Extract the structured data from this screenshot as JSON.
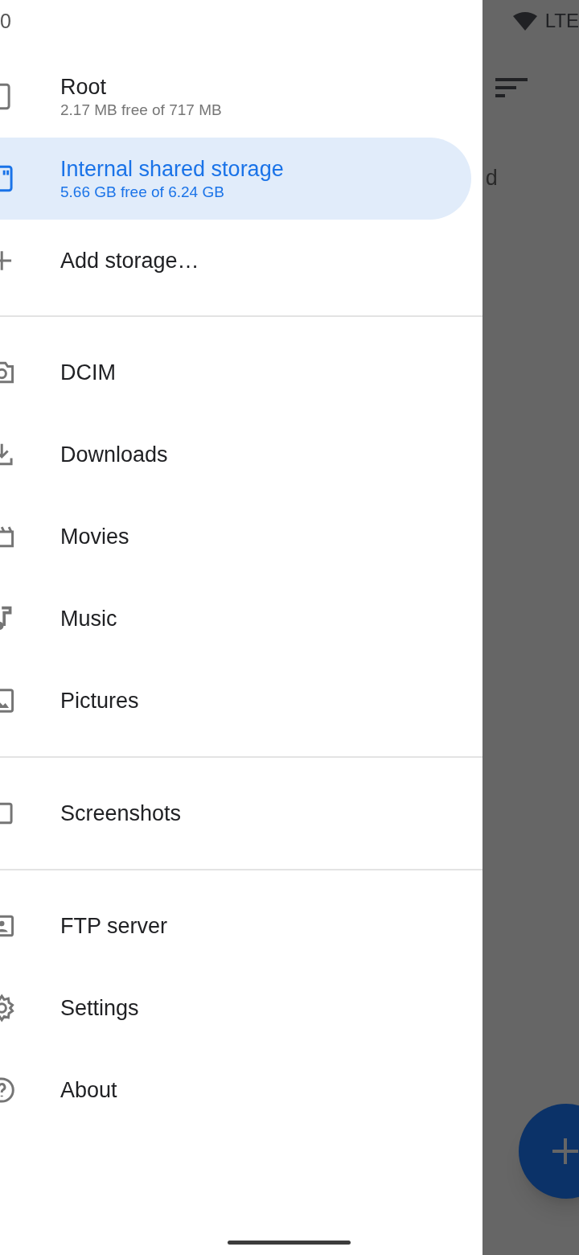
{
  "status_bar": {
    "time": "0",
    "network": "LTE"
  },
  "drawer": {
    "sections": [
      {
        "items": [
          {
            "label": "Root",
            "subtitle": "2.17 MB free of 717 MB",
            "selected": false
          },
          {
            "label": "Internal shared storage",
            "subtitle": "5.66 GB free of 6.24 GB",
            "selected": true
          },
          {
            "label": "Add storage…",
            "selected": false
          }
        ]
      },
      {
        "items": [
          {
            "label": "DCIM",
            "selected": false
          },
          {
            "label": "Downloads",
            "selected": false
          },
          {
            "label": "Movies",
            "selected": false
          },
          {
            "label": "Music",
            "selected": false
          },
          {
            "label": "Pictures",
            "selected": false
          }
        ]
      },
      {
        "items": [
          {
            "label": "Screenshots",
            "selected": false
          }
        ]
      },
      {
        "items": [
          {
            "label": "FTP server",
            "selected": false
          },
          {
            "label": "Settings",
            "selected": false
          },
          {
            "label": "About",
            "selected": false
          }
        ]
      }
    ]
  },
  "background": {
    "partial_text": "d"
  }
}
